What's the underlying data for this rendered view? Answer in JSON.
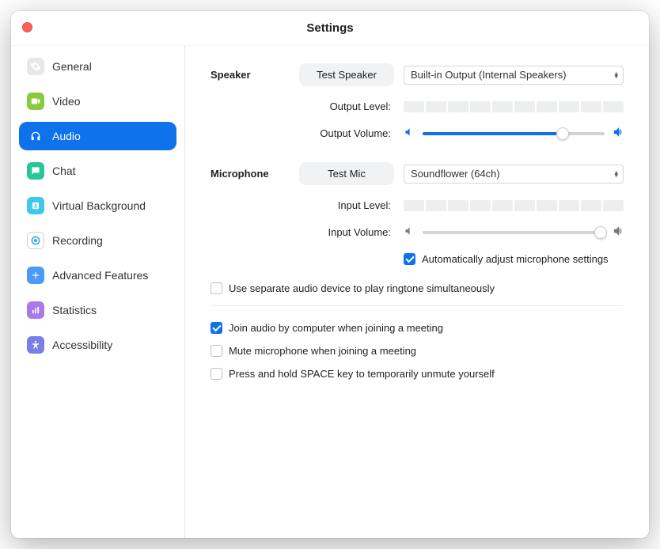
{
  "title": "Settings",
  "sidebar": {
    "items": [
      {
        "label": "General"
      },
      {
        "label": "Video"
      },
      {
        "label": "Audio"
      },
      {
        "label": "Chat"
      },
      {
        "label": "Virtual Background"
      },
      {
        "label": "Recording"
      },
      {
        "label": "Advanced Features"
      },
      {
        "label": "Statistics"
      },
      {
        "label": "Accessibility"
      }
    ]
  },
  "speaker": {
    "heading": "Speaker",
    "test_btn": "Test Speaker",
    "device": "Built-in Output (Internal Speakers)",
    "output_level_label": "Output Level:",
    "output_volume_label": "Output Volume:",
    "volume_percent": 77
  },
  "microphone": {
    "heading": "Microphone",
    "test_btn": "Test Mic",
    "device": "Soundflower (64ch)",
    "input_level_label": "Input Level:",
    "input_volume_label": "Input Volume:",
    "volume_percent": 98,
    "auto_adjust_label": "Automatically adjust microphone settings",
    "auto_adjust_checked": true
  },
  "options": {
    "ringtone_label": "Use separate audio device to play ringtone simultaneously",
    "ringtone_checked": false,
    "join_audio_label": "Join audio by computer when joining a meeting",
    "join_audio_checked": true,
    "mute_on_join_label": "Mute microphone when joining a meeting",
    "mute_on_join_checked": false,
    "space_unmute_label": "Press and hold SPACE key to temporarily unmute yourself",
    "space_unmute_checked": false
  }
}
